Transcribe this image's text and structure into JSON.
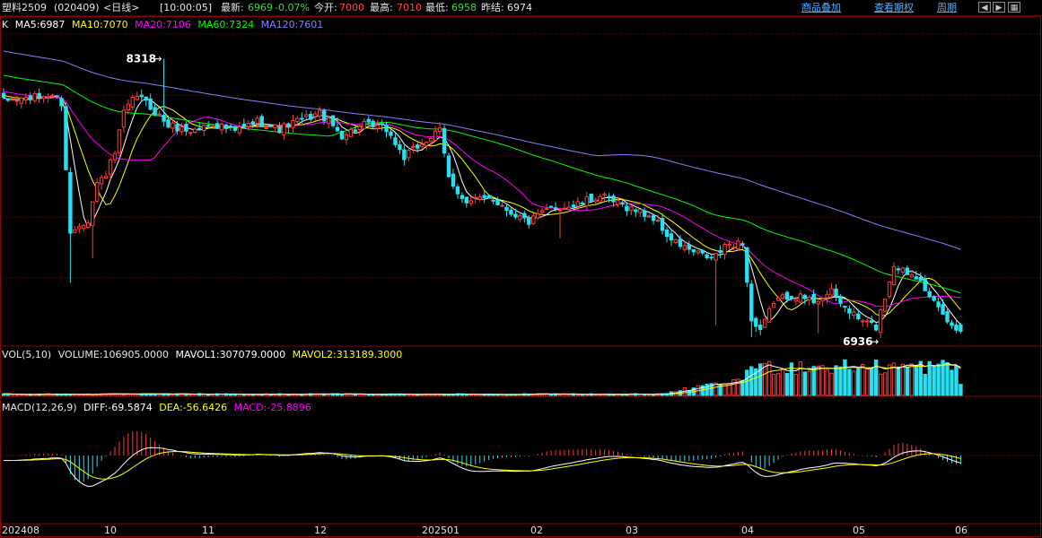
{
  "header": {
    "symbol": "塑料2509",
    "code": "(020409)",
    "period": "<日线>",
    "time": "[10:00:05]",
    "latest_label": "最新:",
    "latest_value": "6969",
    "change": "-0.07%",
    "open_label": "今开:",
    "open_value": "7000",
    "high_label": "最高:",
    "high_value": "7010",
    "low_label": "最低:",
    "low_value": "6958",
    "prev_label": "昨结:",
    "prev_value": "6974",
    "links": [
      "商品叠加",
      "查看期权",
      "周期"
    ],
    "nav_icons": [
      "arrow-left-icon",
      "arrow-right-icon",
      "grid-icon"
    ]
  },
  "price_legend": {
    "k": "K",
    "ma5": "MA5:6987",
    "ma10": "MA10:7070",
    "ma20": "MA20:7106",
    "ma60": "MA60:7324",
    "ma120": "MA120:7601",
    "max_label": "8318",
    "min_label": "6936"
  },
  "volume_legend": {
    "name": "VOL(5,10)",
    "volume": "VOLUME:106905.0000",
    "mavol1": "MAVOL1:307079.0000",
    "mavol2": "MAVOL2:313189.3000"
  },
  "macd_legend": {
    "name": "MACD(12,26,9)",
    "diff": "DIFF:-69.5874",
    "dea": "DEA:-56.6426",
    "macd": "MACD:-25.8896"
  },
  "x_axis": [
    "202408",
    "10",
    "11",
    "12",
    "202501",
    "02",
    "03",
    "04",
    "05",
    "06"
  ],
  "colors": {
    "up": "#ff3b3b",
    "down": "#28e0f0",
    "ma5": "#ffffff",
    "ma10": "#ffff00",
    "ma20": "#ff00ff",
    "ma60": "#00ff00",
    "ma120": "#8080ff",
    "grid": "#8b0000"
  },
  "chart_data": {
    "type": "candlestick",
    "title": "塑料2509 (020409) 日线",
    "price_range": [
      6900,
      8450
    ],
    "max_price": 8318,
    "min_price": 6936,
    "x_ticks": [
      "202408",
      "10",
      "11",
      "12",
      "202501",
      "02",
      "03",
      "04",
      "05",
      "06"
    ],
    "last": {
      "open": 7000,
      "high": 7010,
      "low": 6958,
      "close": 6969,
      "prev_settle": 6974
    },
    "moving_averages": {
      "MA5": 6987,
      "MA10": 7070,
      "MA20": 7106,
      "MA60": 7324,
      "MA120": 7601
    },
    "volume": {
      "VOLUME": 106905.0,
      "MAVOL1": 307079.0,
      "MAVOL2": 313189.3
    },
    "macd": {
      "DIFF": -69.5874,
      "DEA": -56.6426,
      "MACD": -25.8896
    },
    "close_anchors": [
      [
        0,
        8110
      ],
      [
        8,
        8130
      ],
      [
        11,
        8140
      ],
      [
        13,
        8100
      ],
      [
        15,
        7450
      ],
      [
        17,
        7500
      ],
      [
        19,
        7520
      ],
      [
        21,
        7700
      ],
      [
        23,
        7750
      ],
      [
        25,
        7850
      ],
      [
        27,
        8050
      ],
      [
        30,
        8140
      ],
      [
        33,
        8080
      ],
      [
        37,
        7990
      ],
      [
        42,
        7960
      ],
      [
        47,
        8000
      ],
      [
        52,
        7960
      ],
      [
        57,
        8010
      ],
      [
        62,
        7970
      ],
      [
        66,
        8010
      ],
      [
        71,
        8050
      ],
      [
        76,
        7940
      ],
      [
        81,
        7990
      ],
      [
        86,
        7970
      ],
      [
        90,
        7830
      ],
      [
        94,
        7900
      ],
      [
        98,
        7960
      ],
      [
        100,
        7730
      ],
      [
        104,
        7600
      ],
      [
        109,
        7640
      ],
      [
        114,
        7560
      ],
      [
        118,
        7510
      ],
      [
        123,
        7580
      ],
      [
        128,
        7590
      ],
      [
        134,
        7640
      ],
      [
        138,
        7600
      ],
      [
        142,
        7570
      ],
      [
        146,
        7530
      ],
      [
        150,
        7420
      ],
      [
        155,
        7360
      ],
      [
        159,
        7330
      ],
      [
        163,
        7400
      ],
      [
        166,
        7410
      ],
      [
        168,
        7020
      ],
      [
        170,
        6960
      ],
      [
        173,
        7120
      ],
      [
        177,
        7150
      ],
      [
        182,
        7120
      ],
      [
        186,
        7160
      ],
      [
        189,
        7090
      ],
      [
        192,
        7030
      ],
      [
        196,
        6990
      ],
      [
        198,
        7140
      ],
      [
        200,
        7300
      ],
      [
        203,
        7260
      ],
      [
        206,
        7240
      ],
      [
        208,
        7130
      ],
      [
        211,
        7050
      ],
      [
        213,
        6990
      ],
      [
        215,
        6969
      ]
    ],
    "spikes": [
      [
        15,
        7420,
        7210
      ],
      [
        20,
        7330
      ],
      [
        36,
        8318
      ],
      [
        75,
        8030
      ],
      [
        125,
        7430
      ],
      [
        160,
        7000
      ],
      [
        168,
        6940
      ],
      [
        183,
        6960
      ],
      [
        197,
        6936
      ]
    ],
    "series_count": 216
  }
}
